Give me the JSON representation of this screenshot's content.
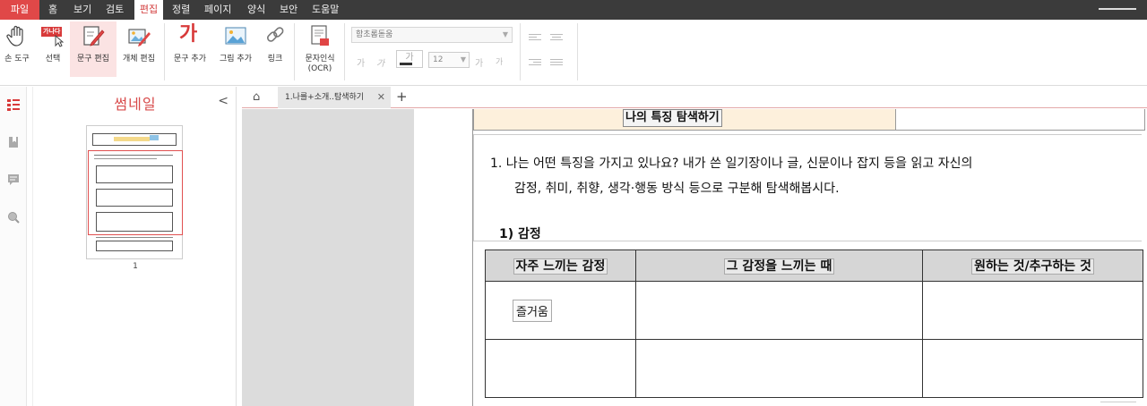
{
  "menu": {
    "items": [
      "파일",
      "홈",
      "보기",
      "검토",
      "편집",
      "정렬",
      "페이지",
      "양식",
      "보안",
      "도움말"
    ],
    "active": "편집"
  },
  "ribbon": {
    "tools": [
      {
        "label": "손 도구",
        "icon": "hand-icon"
      },
      {
        "label": "선택",
        "icon": "select-icon",
        "badge": "가나다"
      },
      {
        "label": "문구 편집",
        "icon": "edit-text-icon"
      },
      {
        "label": "개체 편집",
        "icon": "edit-object-icon"
      },
      {
        "label": "문구 추가",
        "icon": "add-text-icon",
        "glyph": "가"
      },
      {
        "label": "그림 추가",
        "icon": "add-image-icon"
      },
      {
        "label": "링크",
        "icon": "link-icon"
      },
      {
        "label": "문자인식",
        "label2": "(OCR)",
        "icon": "ocr-icon"
      }
    ],
    "font_name": "함초롬돋움",
    "font_size": "12",
    "bold_glyph": "가",
    "italic_glyph": "가",
    "color_glyph": "가",
    "grow_glyph": "가",
    "shrink_glyph": "가"
  },
  "thumbnail_panel": {
    "title": "썸네일",
    "collapse_glyph": "<",
    "page_number": "1"
  },
  "tabs": {
    "home_glyph": "⌂",
    "doc_tab": "1.나를+소개..탐색하기",
    "close_glyph": "✕",
    "new_tab_glyph": "+"
  },
  "document": {
    "heading": "나의 특징 탐색하기",
    "question_line1": "1. 나는 어떤 특징을 가지고 있나요? 내가 쓴 일기장이나 글, 신문이나 잡지 등을 읽고 자신의",
    "question_line2": "감정, 취미, 취향, 생각·행동 방식 등으로 구분해 탐색해봅시다.",
    "sub_heading": "1) 감정",
    "table": {
      "headers": [
        "자주 느끼는 감정",
        "그 감정을 느끼는 때",
        "원하는 것/추구하는 것"
      ],
      "rows": [
        [
          "즐거움",
          "",
          ""
        ],
        [
          "",
          "",
          ""
        ]
      ]
    }
  },
  "colors": {
    "accent": "#d23b3b",
    "menubar": "#3b3b3b",
    "heading_bg": "#fdf0dc",
    "table_header_bg": "#d6d6d6"
  }
}
